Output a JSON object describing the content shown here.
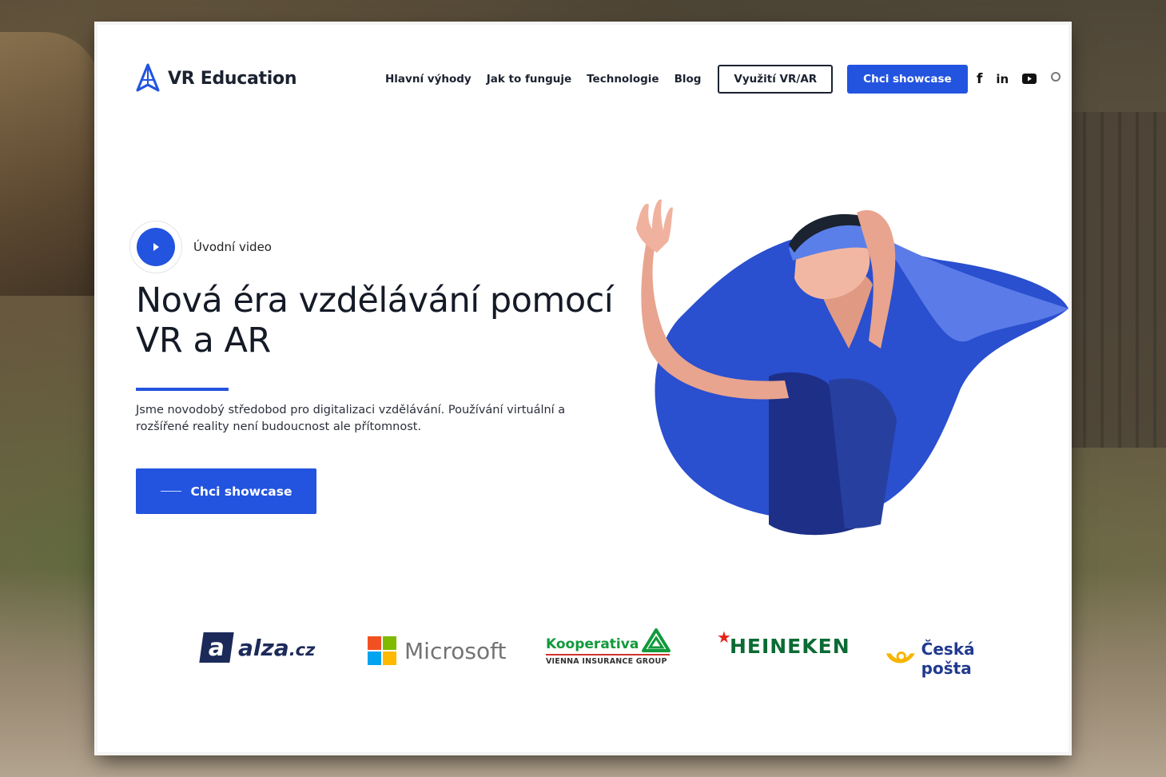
{
  "brand": {
    "name": "VR Education",
    "accent": "#2354e0"
  },
  "nav": {
    "links": [
      "Hlavní výhody",
      "Jak to funguje",
      "Technologie",
      "Blog"
    ],
    "outline_button": "Využití VR/AR",
    "primary_button": "Chci showcase"
  },
  "social": {
    "icons": [
      "facebook-icon",
      "linkedin-icon",
      "youtube-icon",
      "search-icon"
    ],
    "labels": [
      "f",
      "in"
    ]
  },
  "hero": {
    "video_label": "Úvodní video",
    "title": "Nová éra vzdělávání pomocí VR a AR",
    "subtitle": "Jsme novodobý středobod pro digitalizaci vzdělávání. Používání virtuální a rozšířené reality není budoucnost ale přítomnost.",
    "cta_label": "Chci showcase"
  },
  "partners": {
    "alza": {
      "mark": "a",
      "name": "alza",
      "tld": ".cz"
    },
    "microsoft": "Microsoft",
    "kooperativa": {
      "name": "Kooperativa",
      "group": "VIENNA INSURANCE GROUP"
    },
    "heineken": "HEINEKEN",
    "ceska_posta": "Česká pošta"
  }
}
